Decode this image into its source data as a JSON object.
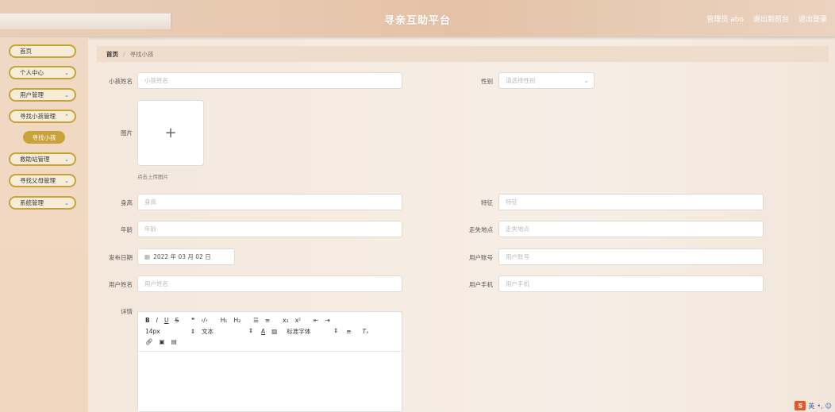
{
  "header": {
    "title": "寻亲互助平台",
    "user_label": "管理员 abo",
    "back_label": "退出到前台",
    "logout_label": "退出登录"
  },
  "sidebar": {
    "items": [
      {
        "label": "首页",
        "has_chevron": false
      },
      {
        "label": "个人中心",
        "has_chevron": true
      },
      {
        "label": "用户管理",
        "has_chevron": true
      },
      {
        "label": "寻找小孩管理",
        "has_chevron": true
      },
      {
        "label": "救助站管理",
        "has_chevron": true
      },
      {
        "label": "寻找父母管理",
        "has_chevron": true
      },
      {
        "label": "系统管理",
        "has_chevron": true
      }
    ],
    "active_sub": "寻找小孩"
  },
  "breadcrumb": {
    "home": "首页",
    "current": "寻找小孩"
  },
  "form": {
    "child_name": {
      "label": "小孩姓名",
      "placeholder": "小孩姓名"
    },
    "gender": {
      "label": "性别",
      "placeholder": "请选择性别"
    },
    "image": {
      "label": "图片",
      "hint": "点击上传图片"
    },
    "height": {
      "label": "身高",
      "placeholder": "身高"
    },
    "features": {
      "label": "特征",
      "placeholder": "特征"
    },
    "age": {
      "label": "年龄",
      "placeholder": "年龄"
    },
    "lost_place": {
      "label": "走失地点",
      "placeholder": "走失地点"
    },
    "publish_date": {
      "label": "发布日期",
      "value": "2022 年 03 月 02 日"
    },
    "user_account": {
      "label": "用户账号",
      "placeholder": "用户账号"
    },
    "user_name": {
      "label": "用户姓名",
      "placeholder": "用户姓名"
    },
    "user_phone": {
      "label": "用户手机",
      "placeholder": "用户手机"
    },
    "details": {
      "label": "详情"
    }
  },
  "editor": {
    "font_size": "14px",
    "paragraph": "文本",
    "font_family": "标准字体"
  },
  "ime": {
    "lang": "英"
  }
}
